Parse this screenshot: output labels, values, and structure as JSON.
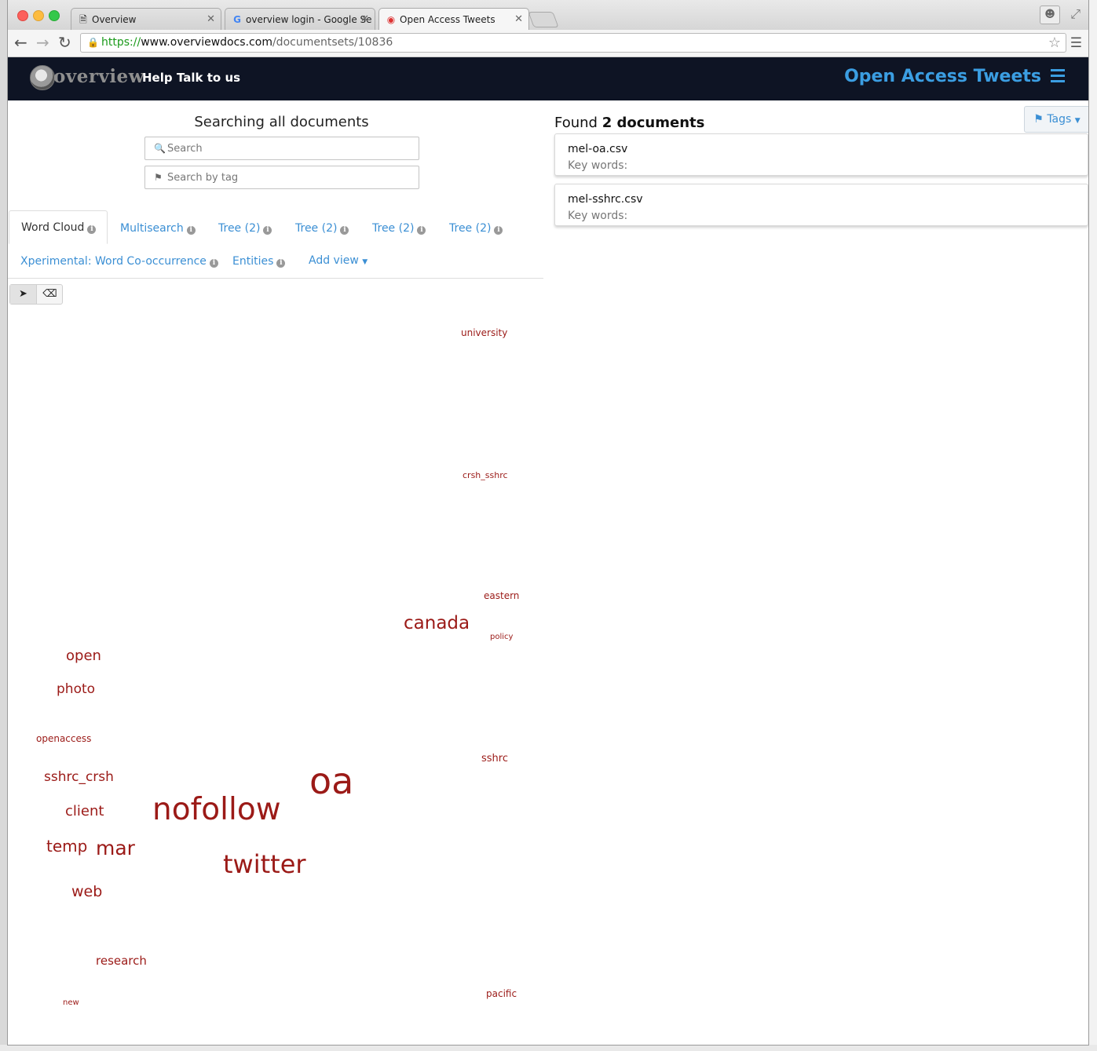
{
  "browser": {
    "tabs": [
      {
        "title": "Overview",
        "icon": "document-icon",
        "active": false
      },
      {
        "title": "overview login - Google Se",
        "icon": "google-icon",
        "active": false
      },
      {
        "title": "Open Access Tweets",
        "icon": "overview-favicon-icon",
        "active": true
      }
    ],
    "url": {
      "scheme": "https://",
      "host": "www.overviewdocs.com",
      "path": "/documentsets/10836"
    }
  },
  "app": {
    "brand": "overview",
    "nav_links": {
      "help": "Help",
      "talk": "Talk to us"
    },
    "docset_title": "Open Access Tweets",
    "accent_color": "#3b9ee2",
    "navbar_color": "#0e1424"
  },
  "search": {
    "heading": "Searching all documents",
    "search_placeholder": "Search",
    "tag_placeholder": "Search by tag"
  },
  "view_tabs": [
    {
      "label": "Word Cloud",
      "active": true
    },
    {
      "label": "Multisearch",
      "active": false
    },
    {
      "label": "Tree (2)",
      "active": false
    },
    {
      "label": "Tree (2)",
      "active": false
    },
    {
      "label": "Tree (2)",
      "active": false
    },
    {
      "label": "Tree (2)",
      "active": false
    },
    {
      "label": "Xperimental: Word Co-occurrence",
      "active": false
    },
    {
      "label": "Entities",
      "active": false
    },
    {
      "label": "Add view",
      "active": false
    }
  ],
  "tools": {
    "select": "select-tool-icon",
    "erase": "eraser-icon"
  },
  "word_cloud": {
    "color": "#9b1a17",
    "words": [
      "university",
      "crsh_sshrc",
      "eastern",
      "canada",
      "policy",
      "open",
      "photo",
      "openaccess",
      "sshrc",
      "oa",
      "sshrc_crsh",
      "nofollow",
      "client",
      "temp",
      "mar",
      "twitter",
      "web",
      "research",
      "pacific",
      "new"
    ]
  },
  "results": {
    "found_prefix": "Found",
    "found_count": "2 documents",
    "tags_button": "Tags",
    "documents": [
      {
        "title": "mel-oa.csv",
        "keywords": "Key words:"
      },
      {
        "title": "mel-sshrc.csv",
        "keywords": "Key words:"
      }
    ]
  }
}
